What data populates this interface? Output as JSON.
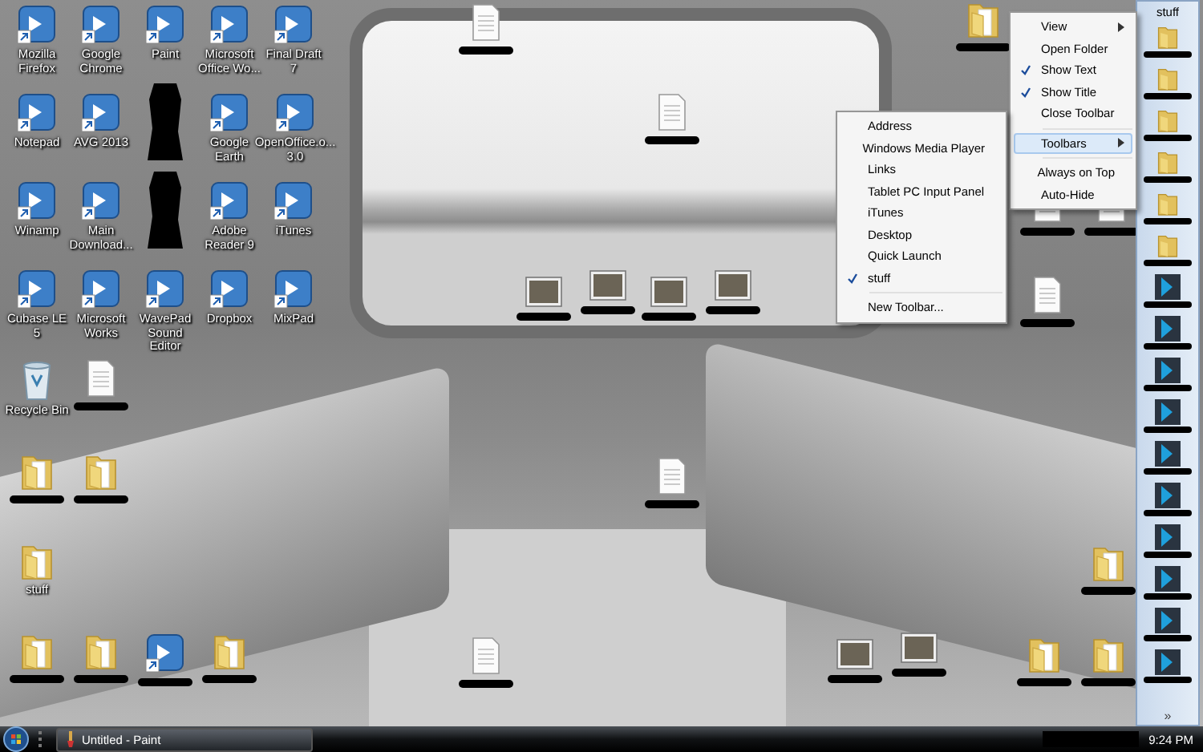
{
  "desktop": {
    "icons": [
      {
        "kind": "app",
        "label": "Mozilla Firefox"
      },
      {
        "kind": "app",
        "label": "Google Chrome"
      },
      {
        "kind": "app",
        "label": "Paint"
      },
      {
        "kind": "app",
        "label": "Microsoft Office Wo..."
      },
      {
        "kind": "app",
        "label": "Final Draft 7"
      },
      {
        "kind": "app",
        "label": "Notepad"
      },
      {
        "kind": "app",
        "label": "AVG 2013"
      },
      {
        "kind": "redacted"
      },
      {
        "kind": "app",
        "label": "Google Earth"
      },
      {
        "kind": "app",
        "label": "OpenOffice.o... 3.0"
      },
      {
        "kind": "app",
        "label": "Winamp"
      },
      {
        "kind": "app",
        "label": "Main Download..."
      },
      {
        "kind": "redacted"
      },
      {
        "kind": "app",
        "label": "Adobe Reader 9"
      },
      {
        "kind": "app",
        "label": "iTunes"
      },
      {
        "kind": "app",
        "label": "Cubase LE 5"
      },
      {
        "kind": "app",
        "label": "Microsoft Works"
      },
      {
        "kind": "app",
        "label": "WavePad Sound Editor"
      },
      {
        "kind": "app",
        "label": "Dropbox"
      },
      {
        "kind": "app",
        "label": "MixPad"
      },
      {
        "kind": "bin",
        "label": "Recycle Bin"
      },
      {
        "kind": "document"
      },
      {
        "kind": "folder"
      },
      {
        "kind": "folder"
      },
      {
        "kind": "folder",
        "label": "stuff"
      },
      {
        "kind": "folder"
      },
      {
        "kind": "folder"
      },
      {
        "kind": "app"
      },
      {
        "kind": "folder"
      },
      {
        "kind": "document"
      },
      {
        "kind": "folder"
      },
      {
        "kind": "document"
      },
      {
        "kind": "picture"
      },
      {
        "kind": "picture"
      },
      {
        "kind": "picture"
      },
      {
        "kind": "picture"
      },
      {
        "kind": "document"
      },
      {
        "kind": "document"
      },
      {
        "kind": "document"
      },
      {
        "kind": "document"
      },
      {
        "kind": "document"
      },
      {
        "kind": "picture"
      },
      {
        "kind": "picture"
      },
      {
        "kind": "folder"
      },
      {
        "kind": "folder"
      },
      {
        "kind": "folder"
      }
    ]
  },
  "toolbar_menu": {
    "items": [
      {
        "kind": "item",
        "label": "View",
        "submenu": true,
        "checked": false,
        "selected": false
      },
      {
        "kind": "item",
        "label": "Open Folder",
        "submenu": false,
        "checked": false,
        "selected": false
      },
      {
        "kind": "item",
        "label": "Show Text",
        "submenu": false,
        "checked": true,
        "selected": false
      },
      {
        "kind": "item",
        "label": "Show Title",
        "submenu": false,
        "checked": true,
        "selected": false
      },
      {
        "kind": "item",
        "label": "Close Toolbar",
        "submenu": false,
        "checked": false,
        "selected": false
      },
      {
        "kind": "separator"
      },
      {
        "kind": "item",
        "label": "Toolbars",
        "submenu": true,
        "checked": false,
        "selected": true
      },
      {
        "kind": "separator"
      },
      {
        "kind": "item",
        "label": "Always on Top",
        "submenu": false,
        "checked": false,
        "selected": false
      },
      {
        "kind": "item",
        "label": "Auto-Hide",
        "submenu": false,
        "checked": false,
        "selected": false
      }
    ]
  },
  "toolbars_submenu": {
    "items": [
      {
        "kind": "item",
        "label": "Address",
        "submenu": false,
        "checked": false,
        "selected": false
      },
      {
        "kind": "item",
        "label": "Windows Media Player",
        "submenu": false,
        "checked": false,
        "selected": false
      },
      {
        "kind": "item",
        "label": "Links",
        "submenu": false,
        "checked": false,
        "selected": false
      },
      {
        "kind": "item",
        "label": "Tablet PC Input Panel",
        "submenu": false,
        "checked": false,
        "selected": false
      },
      {
        "kind": "item",
        "label": "iTunes",
        "submenu": false,
        "checked": false,
        "selected": false
      },
      {
        "kind": "item",
        "label": "Desktop",
        "submenu": false,
        "checked": false,
        "selected": false
      },
      {
        "kind": "item",
        "label": "Quick Launch",
        "submenu": false,
        "checked": false,
        "selected": false
      },
      {
        "kind": "item",
        "label": "stuff",
        "submenu": false,
        "checked": true,
        "selected": false
      },
      {
        "kind": "separator"
      },
      {
        "kind": "item",
        "label": "New Toolbar...",
        "submenu": false,
        "checked": false,
        "selected": false
      }
    ]
  },
  "side_toolbar": {
    "title": "stuff",
    "items": [
      {
        "kind": "folder"
      },
      {
        "kind": "folder"
      },
      {
        "kind": "folder"
      },
      {
        "kind": "folder"
      },
      {
        "kind": "folder"
      },
      {
        "kind": "folder"
      },
      {
        "kind": "app"
      },
      {
        "kind": "app"
      },
      {
        "kind": "app"
      },
      {
        "kind": "app"
      },
      {
        "kind": "app"
      },
      {
        "kind": "app"
      },
      {
        "kind": "app"
      },
      {
        "kind": "app"
      },
      {
        "kind": "app"
      },
      {
        "kind": "app"
      }
    ],
    "more": "»"
  },
  "taskbar": {
    "tasks": [
      {
        "label": "Untitled - Paint",
        "selected": false
      }
    ],
    "clock": "9:24 PM"
  }
}
